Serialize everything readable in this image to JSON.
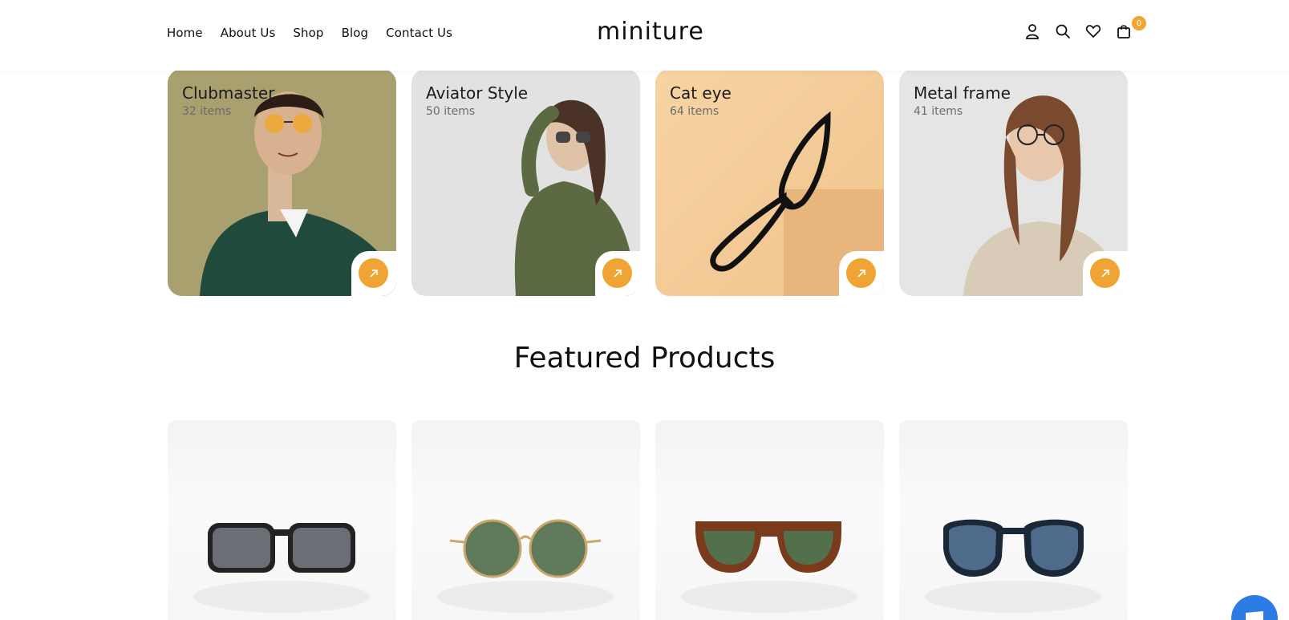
{
  "header": {
    "nav": [
      "Home",
      "About Us",
      "Shop",
      "Blog",
      "Contact Us"
    ],
    "logo": "miniture",
    "cart_count": "0",
    "icons": [
      "user-icon",
      "search-icon",
      "heart-icon",
      "shopping-bag-icon"
    ]
  },
  "categories": [
    {
      "title": "Clubmaster",
      "count": "32 items"
    },
    {
      "title": "Aviator Style",
      "count": "50 items"
    },
    {
      "title": "Cat eye",
      "count": "64 items"
    },
    {
      "title": "Metal frame",
      "count": "41 items"
    }
  ],
  "featured": {
    "title": "Featured Products"
  },
  "colors": {
    "accent": "#f0a434",
    "chat": "#2d7be5"
  }
}
